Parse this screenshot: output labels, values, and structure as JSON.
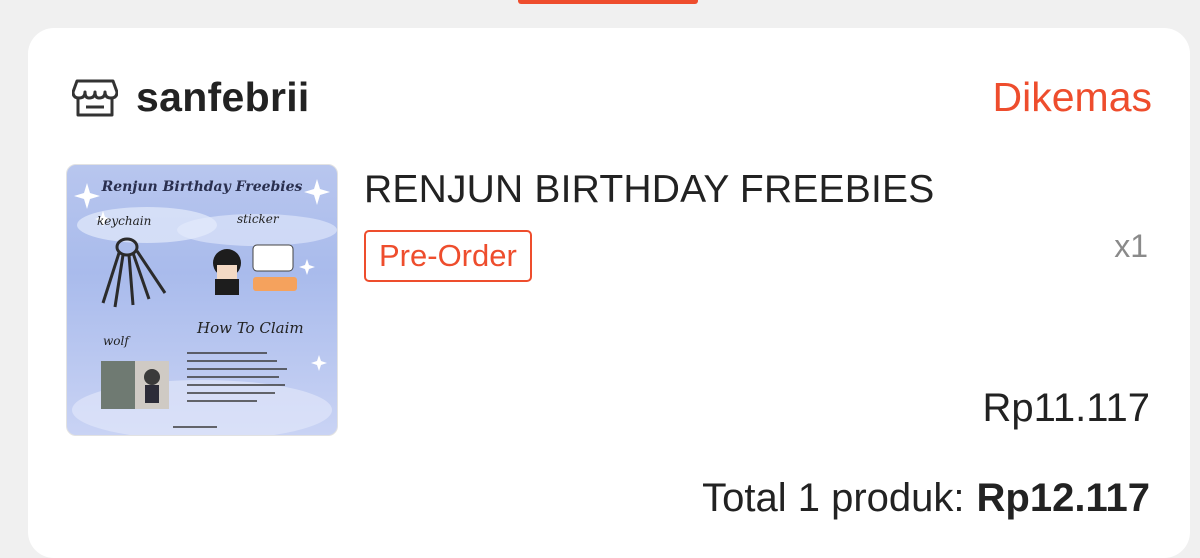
{
  "shop": {
    "name": "sanfebrii",
    "status": "Dikemas"
  },
  "product": {
    "title": "RENJUN BIRTHDAY FREEBIES",
    "badge": "Pre-Order",
    "quantity": "x1",
    "price": "Rp11.117",
    "image": {
      "header_text": "Renjun Birthday Freebies",
      "label_keychain": "keychain",
      "label_sticker": "sticker",
      "label_how_to_claim": "How To Claim",
      "label_wolf": "wolf"
    }
  },
  "total": {
    "label": "Total 1 produk:",
    "amount": "Rp12.117"
  },
  "colors": {
    "accent": "#ee4d2d",
    "text": "#222222",
    "muted": "#8a8a8a",
    "background": "#f0f0f0",
    "card": "#ffffff"
  },
  "icons": {
    "shop": "store-icon"
  }
}
